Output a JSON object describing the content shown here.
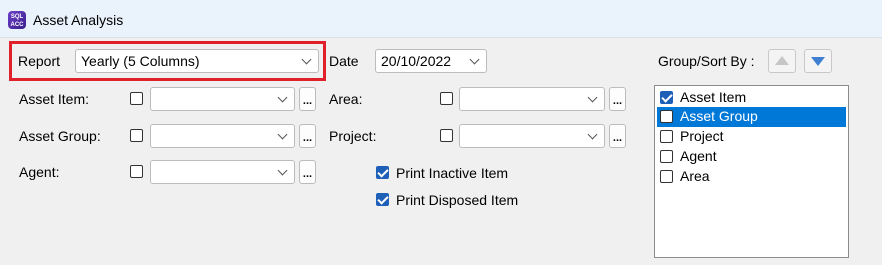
{
  "window": {
    "title": "Asset Analysis",
    "icon_text": "SQL ACC",
    "icon": "app-logo-icon"
  },
  "colors": {
    "highlight_border": "#e0212b",
    "selection": "#0078d7",
    "checkbox_checked": "#1e5fb8"
  },
  "form": {
    "report_label": "Report",
    "report_value": "Yearly (5 Columns)",
    "date_label": "Date",
    "date_value": "20/10/2022",
    "asset_item_label": "Asset Item:",
    "asset_group_label": "Asset Group:",
    "agent_label": "Agent:",
    "area_label": "Area:",
    "project_label": "Project:",
    "ellipsis": "...",
    "print_inactive": {
      "label": "Print Inactive Item",
      "checked": true
    },
    "print_disposed": {
      "label": "Print Disposed Item",
      "checked": true
    }
  },
  "group_sort": {
    "label": "Group/Sort By :",
    "items": [
      {
        "label": "Asset Item",
        "checked": true,
        "selected": false
      },
      {
        "label": "Asset Group",
        "checked": false,
        "selected": true
      },
      {
        "label": "Project",
        "checked": false,
        "selected": false
      },
      {
        "label": "Agent",
        "checked": false,
        "selected": false
      },
      {
        "label": "Area",
        "checked": false,
        "selected": false
      }
    ]
  }
}
